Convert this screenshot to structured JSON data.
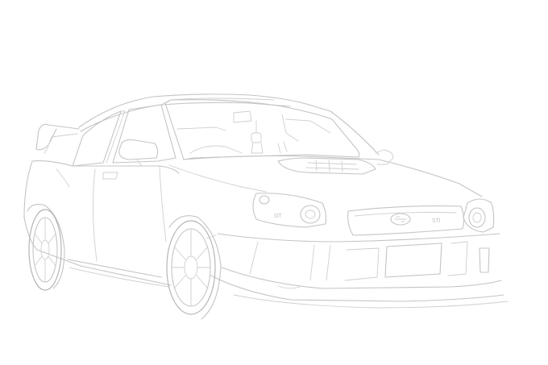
{
  "scene": {
    "subject": "",
    "background_color": "#ffffff",
    "line_color": "#c4c4c4"
  },
  "badges": {
    "headlight_text": "GT",
    "grille_emblem_text": "STi"
  }
}
